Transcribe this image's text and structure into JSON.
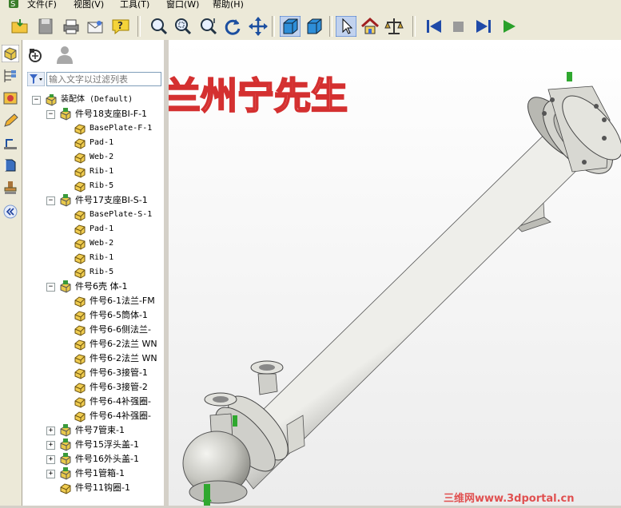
{
  "menu": [
    "文件(F)",
    "视图(V)",
    "工具(T)",
    "窗口(W)",
    "帮助(H)"
  ],
  "tree": {
    "filter_placeholder": "输入文字以过滤列表",
    "nodes": [
      {
        "label": "装配体 (Default)",
        "level": 0,
        "expand": "−",
        "icon": "assembly-icon",
        "mono": true
      },
      {
        "label": "件号18支座BI-F-1",
        "level": 1,
        "expand": "−",
        "icon": "subassembly-icon"
      },
      {
        "label": "BasePlate-F-1",
        "level": 2,
        "icon": "part-icon",
        "mono": true
      },
      {
        "label": "Pad-1",
        "level": 2,
        "icon": "part-icon",
        "mono": true
      },
      {
        "label": "Web-2",
        "level": 2,
        "icon": "part-icon",
        "mono": true
      },
      {
        "label": "Rib-1",
        "level": 2,
        "icon": "part-icon",
        "mono": true
      },
      {
        "label": "Rib-5",
        "level": 2,
        "icon": "part-icon",
        "mono": true
      },
      {
        "label": "件号17支座BI-S-1",
        "level": 1,
        "expand": "−",
        "icon": "subassembly-icon"
      },
      {
        "label": "BasePlate-S-1",
        "level": 2,
        "icon": "part-icon",
        "mono": true
      },
      {
        "label": "Pad-1",
        "level": 2,
        "icon": "part-icon",
        "mono": true
      },
      {
        "label": "Web-2",
        "level": 2,
        "icon": "part-icon",
        "mono": true
      },
      {
        "label": "Rib-1",
        "level": 2,
        "icon": "part-icon",
        "mono": true
      },
      {
        "label": "Rib-5",
        "level": 2,
        "icon": "part-icon",
        "mono": true
      },
      {
        "label": "件号6壳 体-1",
        "level": 1,
        "expand": "−",
        "icon": "subassembly-icon"
      },
      {
        "label": "件号6-1法兰-FM",
        "level": 2,
        "icon": "part-icon"
      },
      {
        "label": "件号6-5筒体-1",
        "level": 2,
        "icon": "part-icon"
      },
      {
        "label": "件号6-6侧法兰-",
        "level": 2,
        "icon": "part-icon"
      },
      {
        "label": "件号6-2法兰 WN",
        "level": 2,
        "icon": "part-icon"
      },
      {
        "label": "件号6-2法兰 WN",
        "level": 2,
        "icon": "part-icon"
      },
      {
        "label": "件号6-3接管-1",
        "level": 2,
        "icon": "part-icon"
      },
      {
        "label": "件号6-3接管-2",
        "level": 2,
        "icon": "part-icon"
      },
      {
        "label": "件号6-4补强圈-",
        "level": 2,
        "icon": "part-icon"
      },
      {
        "label": "件号6-4补强圈-",
        "level": 2,
        "icon": "part-icon"
      },
      {
        "label": "件号7管束-1",
        "level": 1,
        "expand": "+",
        "icon": "subassembly-icon"
      },
      {
        "label": "件号15浮头盖-1",
        "level": 1,
        "expand": "+",
        "icon": "subassembly-icon"
      },
      {
        "label": "件号16外头盖-1",
        "level": 1,
        "expand": "+",
        "icon": "subassembly-icon"
      },
      {
        "label": "件号1管箱-1",
        "level": 1,
        "expand": "+",
        "icon": "subassembly-icon"
      },
      {
        "label": "件号11钩圈-1",
        "level": 1,
        "icon": "part-icon"
      }
    ]
  },
  "watermark": "兰州宁先生",
  "site_credit": "三维网www.3dportal.cn",
  "colors": {
    "watermark": "#d43030",
    "credit": "#e05050",
    "model": "#c8c8c4",
    "background": "#f3f3f3"
  }
}
